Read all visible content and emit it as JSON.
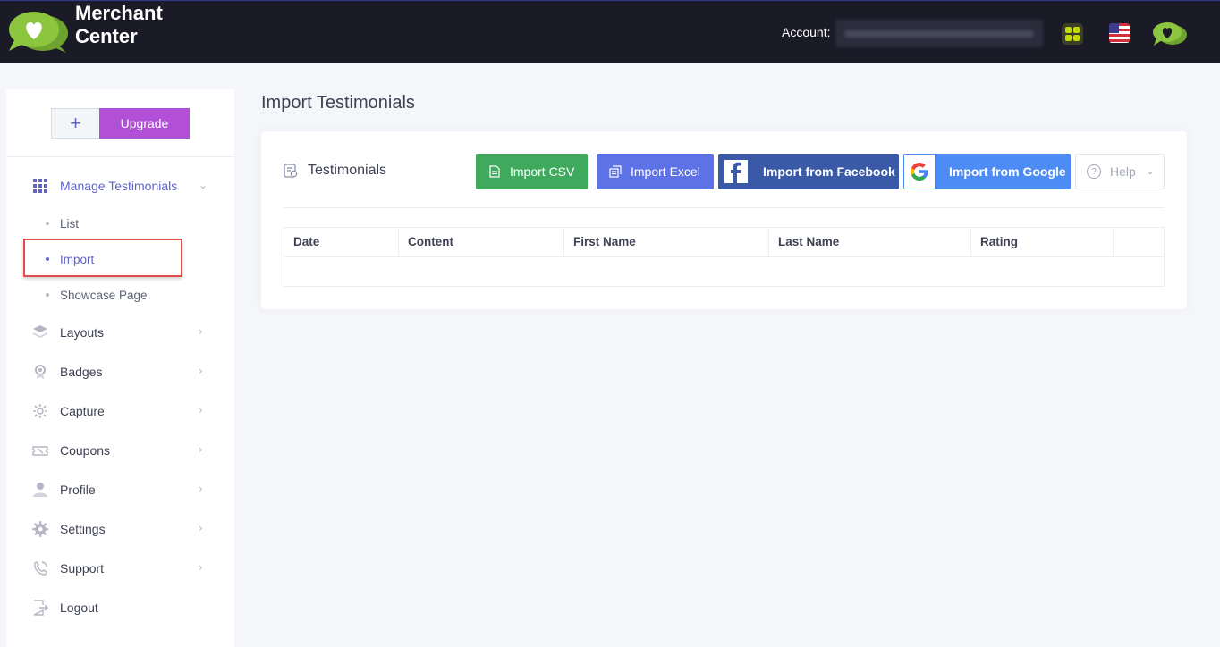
{
  "header": {
    "brand_line1": "Merchant",
    "brand_line2": "Center",
    "account_label": "Account:",
    "account_value": "",
    "icons": [
      "heart-chat-logo-icon",
      "apps-grid-icon",
      "us-flag-icon",
      "heart-chat-logo-icon"
    ],
    "colors": {
      "background": "#1b1b28",
      "logo_green": "#8cc63f",
      "apps_accent": "#c5d900"
    }
  },
  "sidebar": {
    "plus_label": "+",
    "upgrade_label": "Upgrade",
    "menu": [
      {
        "label": "Manage Testimonials",
        "icon": "grid-icon",
        "active": true
      },
      {
        "label": "Layouts",
        "icon": "layers-icon"
      },
      {
        "label": "Badges",
        "icon": "badge-icon"
      },
      {
        "label": "Capture",
        "icon": "capture-icon"
      },
      {
        "label": "Coupons",
        "icon": "ticket-icon"
      },
      {
        "label": "Profile",
        "icon": "user-icon"
      },
      {
        "label": "Settings",
        "icon": "gear-icon"
      },
      {
        "label": "Support",
        "icon": "support-icon"
      },
      {
        "label": "Logout",
        "icon": "logout-icon"
      }
    ],
    "submenu": [
      {
        "label": "List"
      },
      {
        "label": "Import",
        "active": true
      },
      {
        "label": "Showcase Page"
      }
    ],
    "colors": {
      "accent": "#5f64c7",
      "upgrade": "#b14fd6",
      "highlight": "#e14d4d"
    }
  },
  "main": {
    "page_title": "Import Testimonials",
    "card_title": "Testimonials",
    "buttons": {
      "csv": "Import CSV",
      "excel": "Import Excel",
      "facebook": "Import from Facebook",
      "google": "Import from Google",
      "help": "Help"
    },
    "table": {
      "columns": [
        "Date",
        "Content",
        "First Name",
        "Last Name",
        "Rating",
        ""
      ],
      "rows": []
    },
    "colors": {
      "csv": "#3fa95e",
      "excel": "#5c72e6",
      "facebook": "#3a5aa8",
      "google": "#4d8cf5"
    }
  }
}
